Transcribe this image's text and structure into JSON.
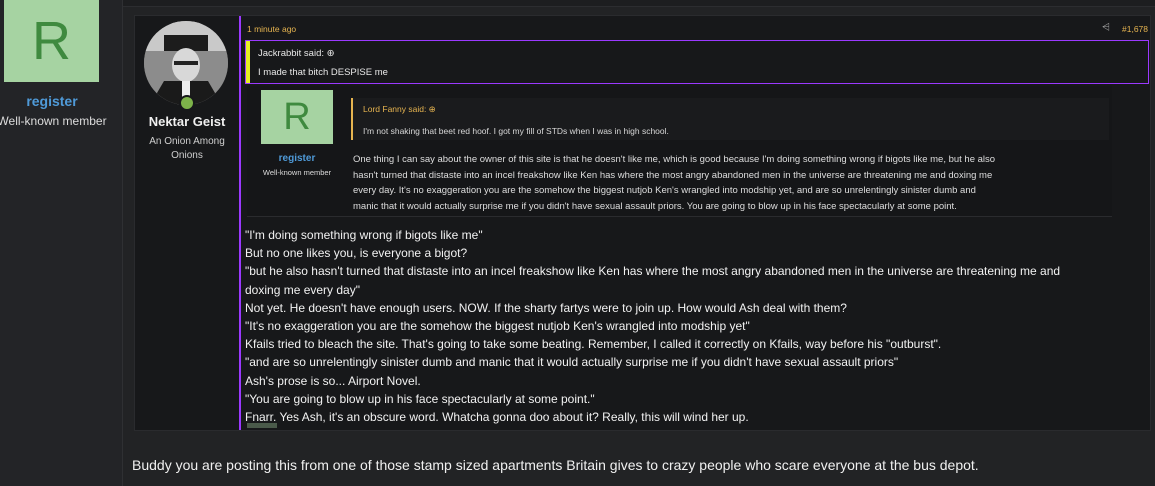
{
  "outer_user": {
    "avatar_letter": "R",
    "name": "register",
    "title": "Well-known member"
  },
  "post": {
    "author": "Nektar Geist",
    "author_title": "An Onion Among Onions",
    "time": "1 minute ago",
    "share_icon": "share-icon",
    "number": "#1,678",
    "quote1": {
      "who": "Jackrabbit said: ⊕",
      "text": "I made that bitch DESPISE me"
    },
    "inner": {
      "avatar_letter": "R",
      "name": "register",
      "title": "Well-known member",
      "quote": {
        "who": "Lord Fanny said: ⊕",
        "text": "I'm not shaking that beet red hoof. I got my fill of STDs when I was in high school."
      },
      "lines": [
        "One thing I can say about the owner of this site is that he doesn't like me, which is good because I'm doing something wrong if bigots like me, but he also",
        "hasn't turned that distaste into an incel freakshow like Ken has where the most angry abandoned men in the universe are threatening me and doxing me",
        "every day. It's no exaggeration you are the somehow the biggest nutjob Ken's wrangled into modship yet, and are so unrelentingly sinister dumb and",
        "manic that it would actually surprise me if you didn't have sexual assault priors. You are going to blow up in his face spectacularly at some point."
      ]
    },
    "reply_lines": [
      "\"I'm doing something wrong if bigots like me\"",
      "But no one likes you, is everyone a bigot?",
      "\"but he also hasn't turned that distaste into an incel freakshow like Ken has where the most angry abandoned men in the universe are threatening me and",
      "doxing me every day\"",
      "Not yet. He doesn't have enough users. NOW. If the sharty fartys were to join up. How would Ash deal with them?",
      "\"It's no exaggeration you are the somehow the biggest nutjob Ken's wrangled into modship yet\"",
      "Kfails tried to bleach the site. That's going to take some beating. Remember, I called it correctly on Kfails, way before his \"outburst\".",
      "\"and are so unrelentingly sinister dumb and manic that it would actually surprise me if you didn't have sexual assault priors\"",
      "Ash's prose is so... Airport Novel.",
      "\"You are going to blow up in his face spectacularly at some point.\"",
      "Fnarr. Yes Ash, it's an obscure word. Whatcha gonna doo about it? Really, this will wind her up."
    ]
  },
  "bottom_text": "Buddy you are posting this from one of those stamp sized apartments Britain gives to crazy people who scare everyone at the bus depot."
}
